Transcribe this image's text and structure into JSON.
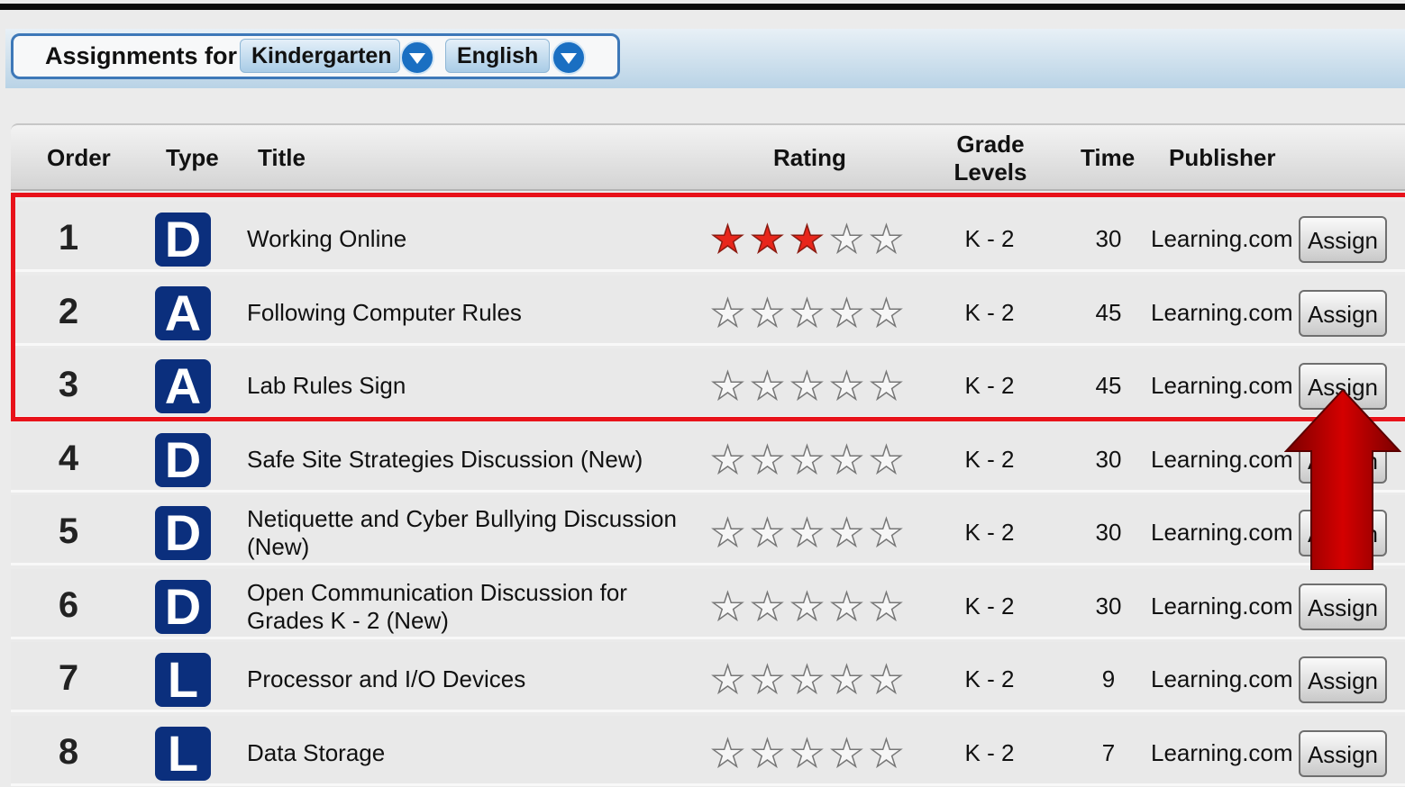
{
  "filter": {
    "label": "Assignments for",
    "grade": "Kindergarten",
    "subject": "English"
  },
  "columns": {
    "order": "Order",
    "type": "Type",
    "title": "Title",
    "rating": "Rating",
    "grade_line1": "Grade",
    "grade_line2": "Levels",
    "time": "Time",
    "publisher": "Publisher"
  },
  "rows": [
    {
      "order": "1",
      "type": "D",
      "title": "Working Online",
      "rating": 3,
      "grade": "K - 2",
      "time": "30",
      "publisher": "Learning.com",
      "action": "Assign"
    },
    {
      "order": "2",
      "type": "A",
      "title": "Following Computer Rules",
      "rating": 0,
      "grade": "K - 2",
      "time": "45",
      "publisher": "Learning.com",
      "action": "Assign"
    },
    {
      "order": "3",
      "type": "A",
      "title": "Lab Rules Sign",
      "rating": 0,
      "grade": "K - 2",
      "time": "45",
      "publisher": "Learning.com",
      "action": "Assign"
    },
    {
      "order": "4",
      "type": "D",
      "title": "Safe Site Strategies Discussion (New)",
      "rating": 0,
      "grade": "K - 2",
      "time": "30",
      "publisher": "Learning.com",
      "action": "Assign"
    },
    {
      "order": "5",
      "type": "D",
      "title": "Netiquette and Cyber Bullying Discussion (New)",
      "rating": 0,
      "grade": "K - 2",
      "time": "30",
      "publisher": "Learning.com",
      "action": "Assign"
    },
    {
      "order": "6",
      "type": "D",
      "title": "Open Communication Discussion for Grades K - 2 (New)",
      "rating": 0,
      "grade": "K - 2",
      "time": "30",
      "publisher": "Learning.com",
      "action": "Assign"
    },
    {
      "order": "7",
      "type": "L",
      "title": "Processor and I/O Devices",
      "rating": 0,
      "grade": "K - 2",
      "time": "9",
      "publisher": "Learning.com",
      "action": "Assign"
    },
    {
      "order": "8",
      "type": "L",
      "title": "Data Storage",
      "rating": 0,
      "grade": "K - 2",
      "time": "7",
      "publisher": "Learning.com",
      "action": "Assign"
    }
  ],
  "rating_max": 5,
  "colors": {
    "badge": "#0b2f7d",
    "highlight": "#e8121a",
    "arrow": "#c40000",
    "star_on": "#e8261b"
  },
  "icons": {
    "select_arrow": "chevron-down-icon",
    "arrow": "up-arrow-annotation"
  }
}
